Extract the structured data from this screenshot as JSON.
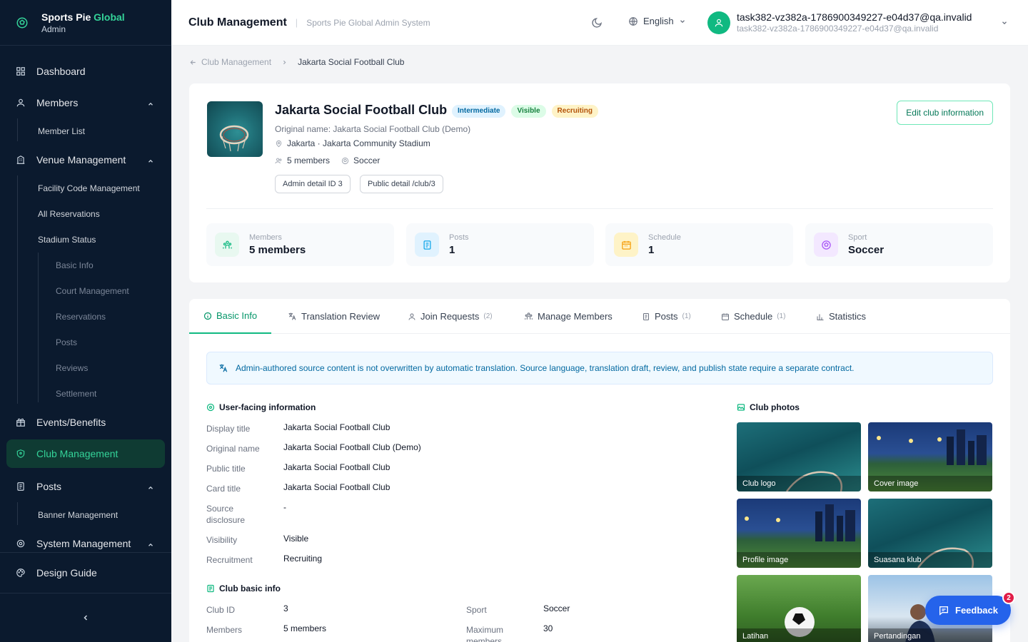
{
  "brand": {
    "name_main": "Sports Pie ",
    "name_accent": "Global",
    "role": "Admin"
  },
  "nav": {
    "dashboard": "Dashboard",
    "members": "Members",
    "member_list": "Member List",
    "venue": "Venue Management",
    "facility_code": "Facility Code Management",
    "all_reservations": "All Reservations",
    "stadium_status": "Stadium Status",
    "basic_info": "Basic Info",
    "court_mgmt": "Court Management",
    "reservations": "Reservations",
    "posts_sub": "Posts",
    "reviews": "Reviews",
    "settlement": "Settlement",
    "events": "Events/Benefits",
    "club_mgmt": "Club Management",
    "posts": "Posts",
    "banner": "Banner Management",
    "system": "System Management",
    "design": "Design Guide"
  },
  "topbar": {
    "title": "Club Management",
    "subtitle": "Sports Pie Global Admin System",
    "language": "English",
    "user_email": "task382-vz382a-1786900349227-e04d37@qa.invalid",
    "user_email_sub": "task382-vz382a-1786900349227-e04d37@qa.invalid"
  },
  "breadcrumb": {
    "parent": "Club Management",
    "current": "Jakarta Social Football Club"
  },
  "club": {
    "name": "Jakarta Social Football Club",
    "badges": [
      "Intermediate",
      "Visible",
      "Recruiting"
    ],
    "original_name": "Original name: Jakarta Social Football Club (Demo)",
    "location": "Jakarta · Jakarta Community Stadium",
    "members": "5 members",
    "sport": "Soccer",
    "chip_admin": "Admin detail ID 3",
    "chip_public": "Public detail /club/3",
    "edit_label": "Edit club information"
  },
  "stats": [
    {
      "label": "Members",
      "value": "5 members"
    },
    {
      "label": "Posts",
      "value": "1"
    },
    {
      "label": "Schedule",
      "value": "1"
    },
    {
      "label": "Sport",
      "value": "Soccer"
    }
  ],
  "tabs": [
    {
      "label": "Basic Info",
      "count": ""
    },
    {
      "label": "Translation Review",
      "count": ""
    },
    {
      "label": "Join Requests",
      "count": "(2)"
    },
    {
      "label": "Manage Members",
      "count": ""
    },
    {
      "label": "Posts",
      "count": "(1)"
    },
    {
      "label": "Schedule",
      "count": "(1)"
    },
    {
      "label": "Statistics",
      "count": ""
    }
  ],
  "notice": "Admin-authored source content is not overwritten by automatic translation. Source language, translation draft, review, and publish state require a separate contract.",
  "user_info": {
    "title": "User-facing information",
    "rows": [
      {
        "label": "Display title",
        "value": "Jakarta Social Football Club"
      },
      {
        "label": "Original name",
        "value": "Jakarta Social Football Club (Demo)"
      },
      {
        "label": "Public title",
        "value": "Jakarta Social Football Club"
      },
      {
        "label": "Card title",
        "value": "Jakarta Social Football Club"
      },
      {
        "label": "Source disclosure",
        "value": "-"
      },
      {
        "label": "Visibility",
        "value": "Visible"
      },
      {
        "label": "Recruitment",
        "value": "Recruiting"
      }
    ]
  },
  "basic_info": {
    "title": "Club basic info",
    "club_id_label": "Club ID",
    "club_id": "3",
    "members_label": "Members",
    "members": "5 members",
    "sport_label": "Sport",
    "sport": "Soccer",
    "max_label": "Maximum members",
    "max": "30"
  },
  "photos": {
    "title": "Club photos",
    "items": [
      "Club logo",
      "Cover image",
      "Profile image",
      "Suasana klub",
      "Latihan",
      "Pertandingan"
    ]
  },
  "feedback": {
    "label": "Feedback",
    "count": "2"
  },
  "colors": {
    "accent": "#10b981",
    "sidebar": "#0b1a2e",
    "feedback": "#2563eb"
  }
}
